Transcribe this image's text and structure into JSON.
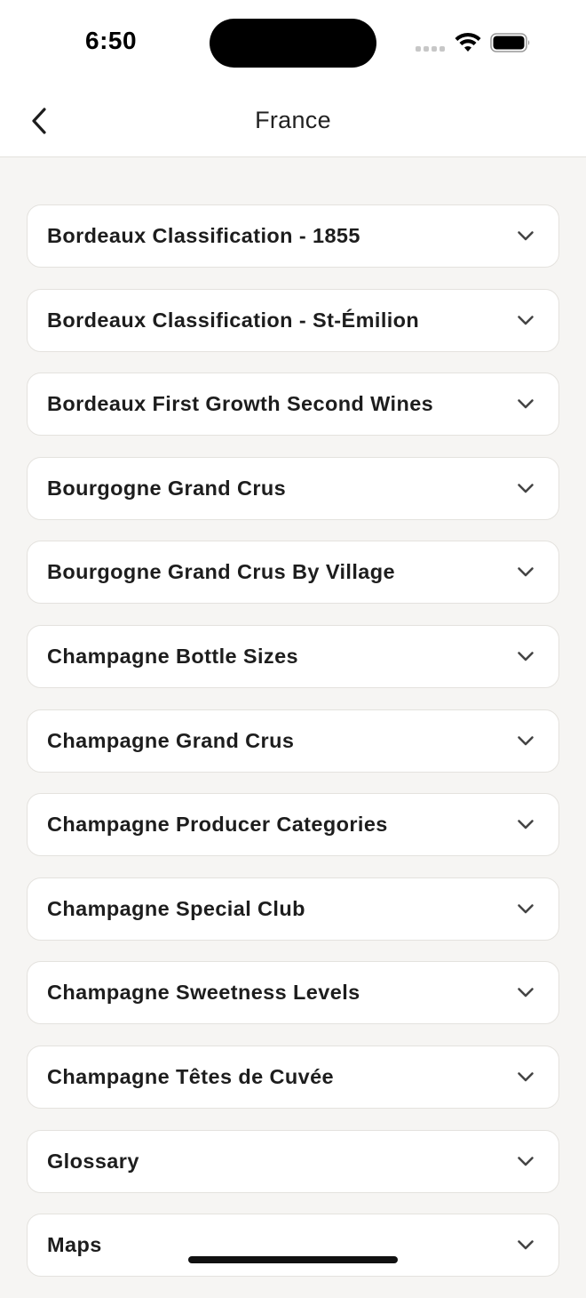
{
  "status_bar": {
    "time": "6:50"
  },
  "nav": {
    "title": "France"
  },
  "items": [
    {
      "label": "Bordeaux Classification - 1855"
    },
    {
      "label": "Bordeaux Classification - St-Émilion"
    },
    {
      "label": "Bordeaux First Growth Second Wines"
    },
    {
      "label": "Bourgogne Grand Crus"
    },
    {
      "label": "Bourgogne Grand Crus By Village"
    },
    {
      "label": "Champagne Bottle Sizes"
    },
    {
      "label": "Champagne Grand Crus"
    },
    {
      "label": "Champagne Producer Categories"
    },
    {
      "label": "Champagne Special Club"
    },
    {
      "label": "Champagne Sweetness Levels"
    },
    {
      "label": "Champagne Têtes de Cuvée"
    },
    {
      "label": "Glossary"
    },
    {
      "label": "Maps"
    }
  ],
  "icons": {
    "back": "chevron-left-icon",
    "expand": "chevron-down-icon",
    "wifi": "wifi-icon",
    "battery": "battery-icon",
    "signal": "cellular-signal-icon"
  },
  "colors": {
    "background": "#f6f5f3",
    "card": "#ffffff",
    "card_border": "#e4e2de",
    "text": "#1d1d1d"
  }
}
